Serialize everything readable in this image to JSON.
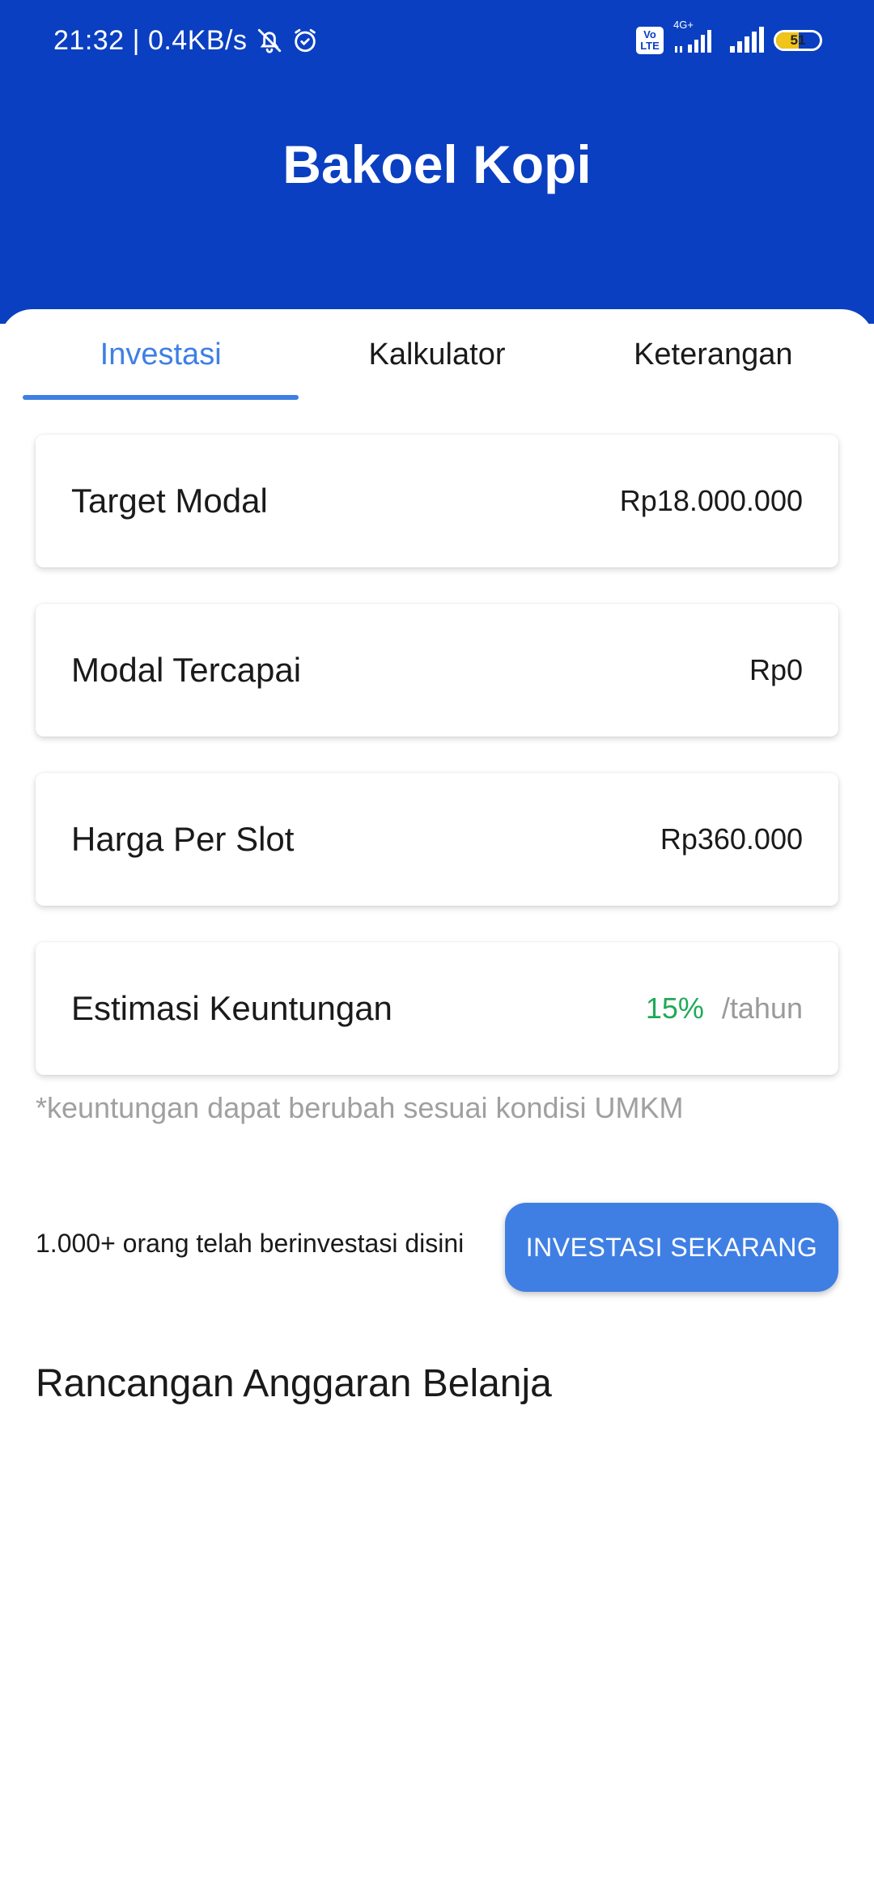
{
  "status_bar": {
    "time": "21:32",
    "speed": "0.4KB/s",
    "volte_top": "Vo",
    "volte_bottom": "LTE",
    "network": "4G+",
    "battery_level": "51",
    "battery_fraction": 0.51
  },
  "app": {
    "title": "Bakoel Kopi"
  },
  "tabs": [
    {
      "label": "Investasi",
      "active": true
    },
    {
      "label": "Kalkulator",
      "active": false
    },
    {
      "label": "Keterangan",
      "active": false
    }
  ],
  "cards": {
    "target_modal": {
      "label": "Target Modal",
      "value": "Rp18.000.000"
    },
    "modal_tercapai": {
      "label": "Modal Tercapai",
      "value": "Rp0"
    },
    "harga_per_slot": {
      "label": "Harga Per Slot",
      "value": "Rp360.000"
    },
    "estimasi_keuntungan": {
      "label": "Estimasi Keuntungan",
      "percent": "15%",
      "unit": "/tahun"
    }
  },
  "note": "*keuntungan dapat berubah sesuai kondisi UMKM",
  "investors_text": "1.000+ orang telah berinvestasi disini",
  "invest_button": "INVESTASI SEKARANG",
  "section_title": "Rancangan Anggaran Belanja",
  "colors": {
    "header": "#0b3fc1",
    "accent": "#3f7fe4",
    "profit": "#1faa57"
  }
}
